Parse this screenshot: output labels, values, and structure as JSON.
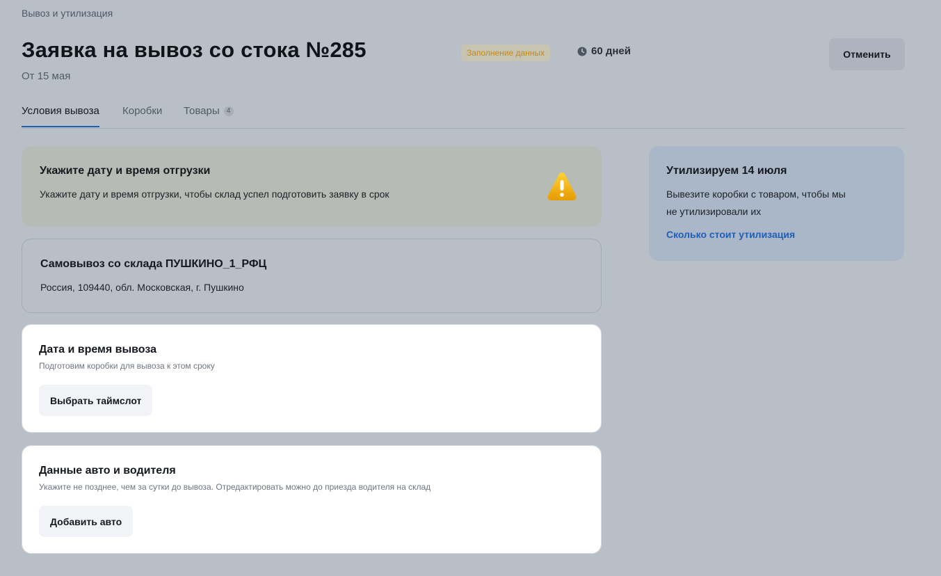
{
  "breadcrumb": "Вывоз и утилизация",
  "header": {
    "title": "Заявка на вывоз со стока №285",
    "subtitle": "От 15 мая",
    "status_badge": "Заполнение данных",
    "deadline": "60 дней",
    "cancel_label": "Отменить"
  },
  "tabs": [
    {
      "label": "Условия вывоза",
      "active": true
    },
    {
      "label": "Коробки"
    },
    {
      "label": "Товары",
      "count": "4"
    }
  ],
  "warning": {
    "heading": "Укажите дату и время отгрузки",
    "text": "Укажите дату и время отгрузки, чтобы склад успел подготовить заявку в срок",
    "icon": "warning-icon"
  },
  "pickup": {
    "heading": "Самовывоз со склада ПУШКИНО_1_РФЦ",
    "address": "Россия, 109440, обл. Московская, г. Пушкино"
  },
  "datetime": {
    "heading": "Дата и время вывоза",
    "hint": "Подготовим коробки для вывоза к этом сроку",
    "button": "Выбрать таймслот"
  },
  "vehicle": {
    "heading": "Данные авто и водителя",
    "hint": "Укажите не позднее, чем за сутки до вывоза. Отредактировать можно до приезда водителя на склад",
    "button": "Добавить авто"
  },
  "utilization": {
    "heading": "Утилизируем 14 июля",
    "text_line1": "Вывезите коробки с товаром, чтобы мы",
    "text_line2": "не утилизировали их",
    "link": "Сколько стоит утилизация"
  },
  "colors": {
    "accent": "#1f5fb8",
    "badge_text": "#c48a1c",
    "warning_icon": "#f2b705"
  }
}
